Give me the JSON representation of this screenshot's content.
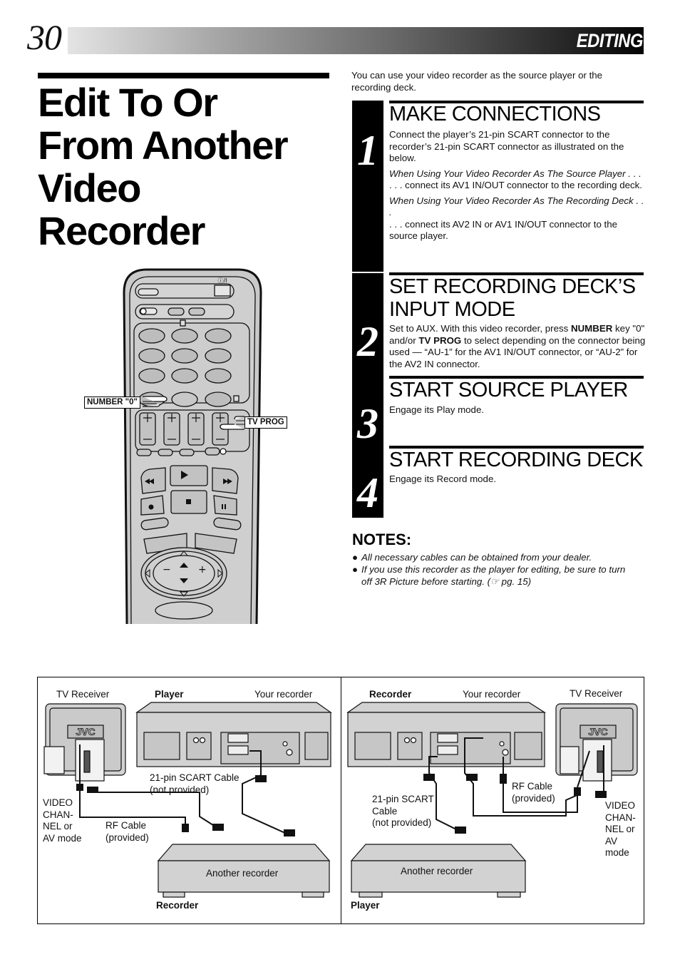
{
  "header": {
    "page_number": "30",
    "section": "EDITING"
  },
  "title": {
    "lines": [
      "Edit To Or",
      "From Another",
      "Video",
      "Recorder"
    ]
  },
  "intro": "You can use your video recorder as the source player or the recording deck.",
  "steps": [
    {
      "number": "1",
      "heading": "MAKE CONNECTIONS",
      "body": "Connect the player’s 21-pin SCART connector to the recorder’s 21-pin SCART connector as illustrated on the below.",
      "source_heading": "When Using Your Video Recorder As The Source Player . . .",
      "source_body": ". . . connect its AV1 IN/OUT connector to the recording deck.",
      "deck_heading": "When Using Your Video Recorder As The Recording Deck . . .",
      "deck_body": " . . . connect its AV2 IN or AV1 IN/OUT connector to the source player."
    },
    {
      "number": "2",
      "heading": "SET RECORDING DECK’S INPUT MODE",
      "body_pre": "Set to AUX. With this video recorder, press ",
      "body_bold1": "NUMBER",
      "body_mid": " key \"0\" and/or ",
      "body_bold2": "TV PROG",
      "body_post": " to select depending on the connector being used — “AU-1” for the AV1 IN/OUT connector, or “AU-2” for the AV2 IN connector."
    },
    {
      "number": "3",
      "heading": "START SOURCE PLAYER",
      "body": "Engage its Play mode."
    },
    {
      "number": "4",
      "heading": "START RECORDING DECK",
      "body": "Engage its Record mode."
    }
  ],
  "notes": {
    "heading": "NOTES:",
    "bullet": "●",
    "items": [
      "All necessary cables can be obtained from your dealer.",
      "If you use this recorder as the player for editing, be sure to turn off 3R Picture before starting. (☞ pg. 15)"
    ]
  },
  "remote": {
    "callout_number": "NUMBER \"0\"",
    "callout_tvprog": "TV PROG",
    "power_label": "⏻/I",
    "plus": "+",
    "minus": "–"
  },
  "diagram": {
    "left": {
      "tv_label": "TV Receiver",
      "player_label": "Player",
      "your_recorder": "Your recorder",
      "scart_cable": "21-pin SCART Cable",
      "scart_note": "(not provided)",
      "video_channel": [
        "VIDEO",
        "CHAN-",
        "NEL or",
        "AV mode"
      ],
      "rf_cable": "RF Cable",
      "rf_note": "(provided)",
      "another_recorder": "Another recorder",
      "bottom_role": "Recorder",
      "tv_brand": "JVC"
    },
    "right": {
      "recorder_label": "Recorder",
      "your_recorder": "Your recorder",
      "tv_label": "TV Receiver",
      "rf_cable": "RF Cable",
      "rf_note": "(provided)",
      "scart_cable": [
        "21-pin SCART",
        "Cable",
        "(not provided)"
      ],
      "video_channel": [
        "VIDEO",
        "CHAN-",
        "NEL or",
        "AV",
        "mode"
      ],
      "another_recorder": "Another recorder",
      "bottom_role": "Player",
      "tv_brand": "JVC"
    }
  }
}
